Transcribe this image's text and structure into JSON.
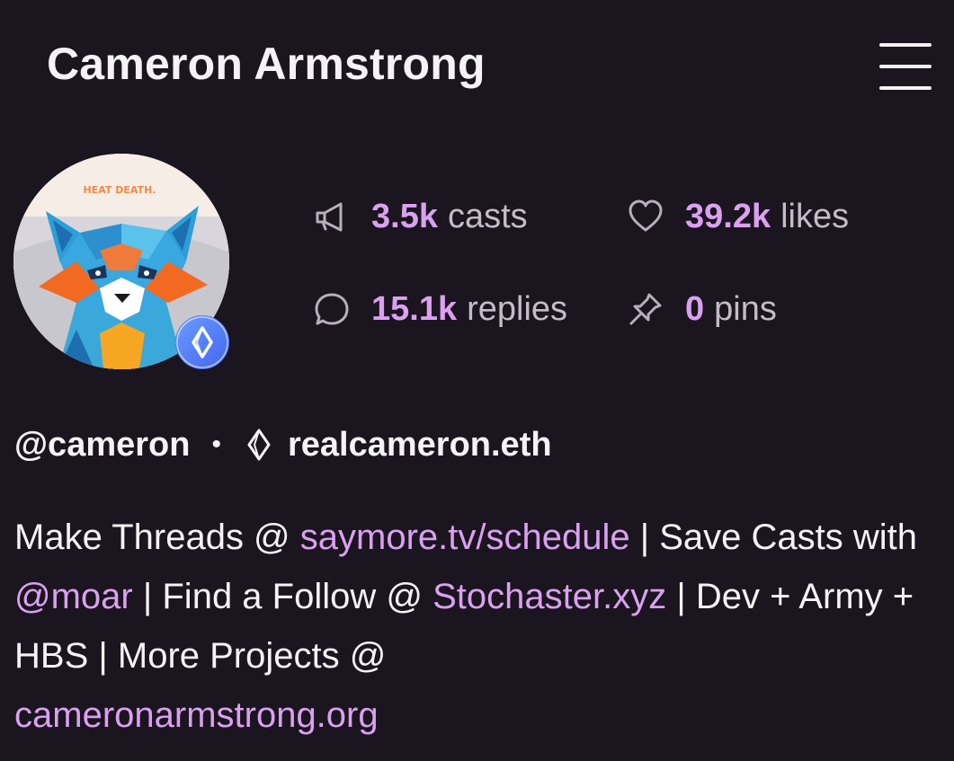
{
  "header": {
    "title": "Cameron Armstrong",
    "menu_icon": "hamburger-menu-icon"
  },
  "profile": {
    "avatar_text": "HEAT DEATH.",
    "ens_badge_icon": "ens-badge-icon",
    "handle": "@cameron",
    "separator": "•",
    "ens_icon": "ens-logo-icon",
    "ens_name": "realcameron.eth"
  },
  "stats": {
    "casts": {
      "value": "3.5k",
      "label": "casts",
      "icon": "megaphone-icon"
    },
    "likes": {
      "value": "39.2k",
      "label": "likes",
      "icon": "heart-icon"
    },
    "replies": {
      "value": "15.1k",
      "label": "replies",
      "icon": "speech-bubble-icon"
    },
    "pins": {
      "value": "0",
      "label": "pins",
      "icon": "pin-icon"
    }
  },
  "bio": {
    "t1": "Make Threads @ ",
    "link1": "saymore.tv/schedule",
    "sep1": " | ",
    "t2": "Save Casts with ",
    "mention1": "@moar",
    "sep2": " | ",
    "t3": "Find a Follow @ ",
    "link2": "Stochaster.xyz",
    "sep3": " | ",
    "t4": "Dev + Army + HBS",
    "sep4": " | ",
    "t5": "More Projects @ ",
    "link3": "cameronarmstrong.org"
  },
  "colors": {
    "background": "#1a151e",
    "accent": "#dba0f0",
    "text": "#f4f2f6",
    "muted": "#c4bcca"
  }
}
